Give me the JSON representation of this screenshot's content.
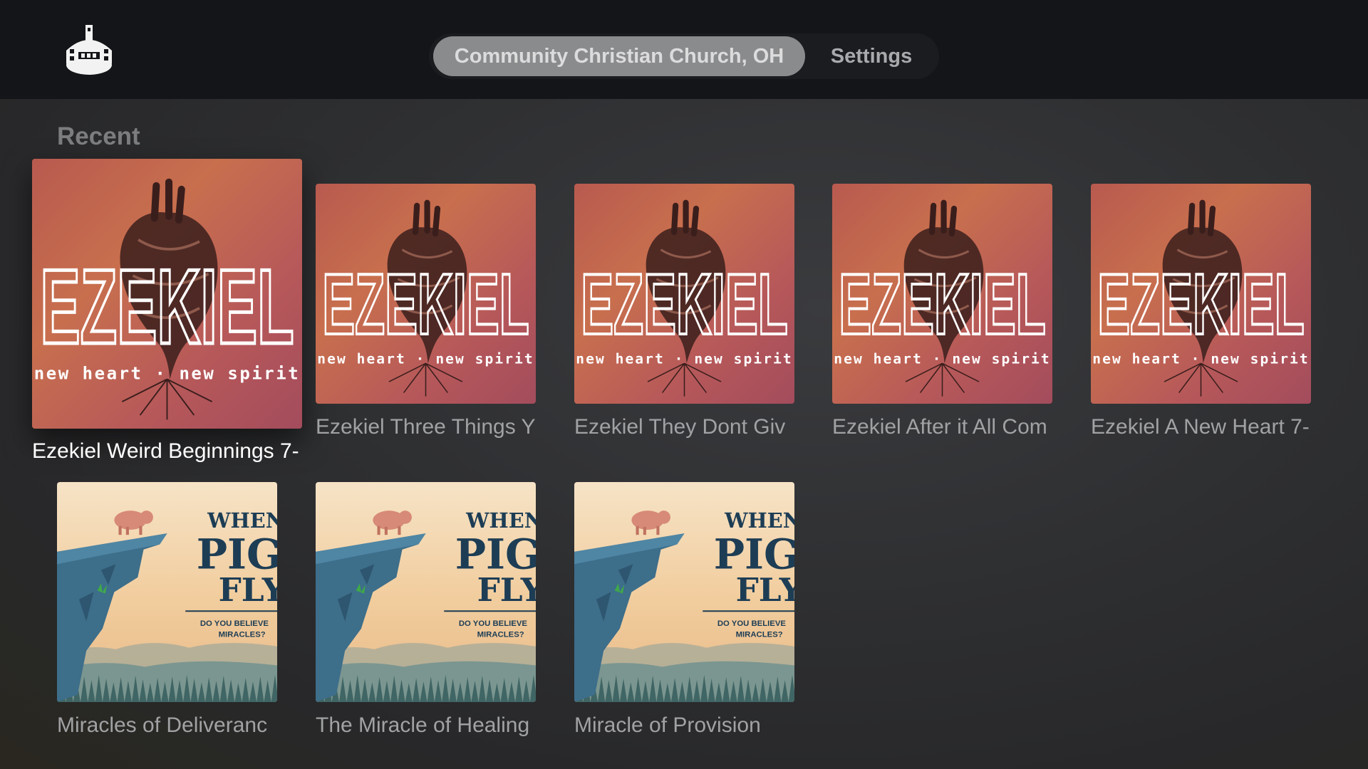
{
  "app": {
    "logo_icon": "church-house-icon"
  },
  "nav": {
    "tabs": [
      {
        "label": "Community Christian Church, OH",
        "selected": true
      },
      {
        "label": "Settings",
        "selected": false
      }
    ]
  },
  "recent": {
    "heading": "Recent",
    "items": [
      {
        "title": "Ezekiel Weird Beginnings 7-",
        "artwork": "ezekiel",
        "focused": true
      },
      {
        "title": "Ezekiel Three Things Y",
        "artwork": "ezekiel",
        "focused": false
      },
      {
        "title": "Ezekiel They Dont Giv",
        "artwork": "ezekiel",
        "focused": false
      },
      {
        "title": "Ezekiel After it All Com",
        "artwork": "ezekiel",
        "focused": false
      },
      {
        "title": "Ezekiel A New Heart 7-",
        "artwork": "ezekiel",
        "focused": false
      },
      {
        "title": "Miracles of Deliveranc",
        "artwork": "pigs",
        "focused": false
      },
      {
        "title": "The Miracle of Healing",
        "artwork": "pigs",
        "focused": false
      },
      {
        "title": "Miracle of Provision",
        "artwork": "pigs",
        "focused": false
      }
    ]
  },
  "artwork": {
    "ezekiel": {
      "title": "EZEKIEL",
      "subtitle": "new heart · new spirit",
      "icon": "anatomical-heart-icon"
    },
    "pigs": {
      "line1": "WHEN",
      "line2": "PIGS",
      "line3": "FLY",
      "tagline1": "DO YOU BELIEVE",
      "tagline2": "MIRACLES?",
      "icon": "pig-on-cliff-icon"
    }
  }
}
